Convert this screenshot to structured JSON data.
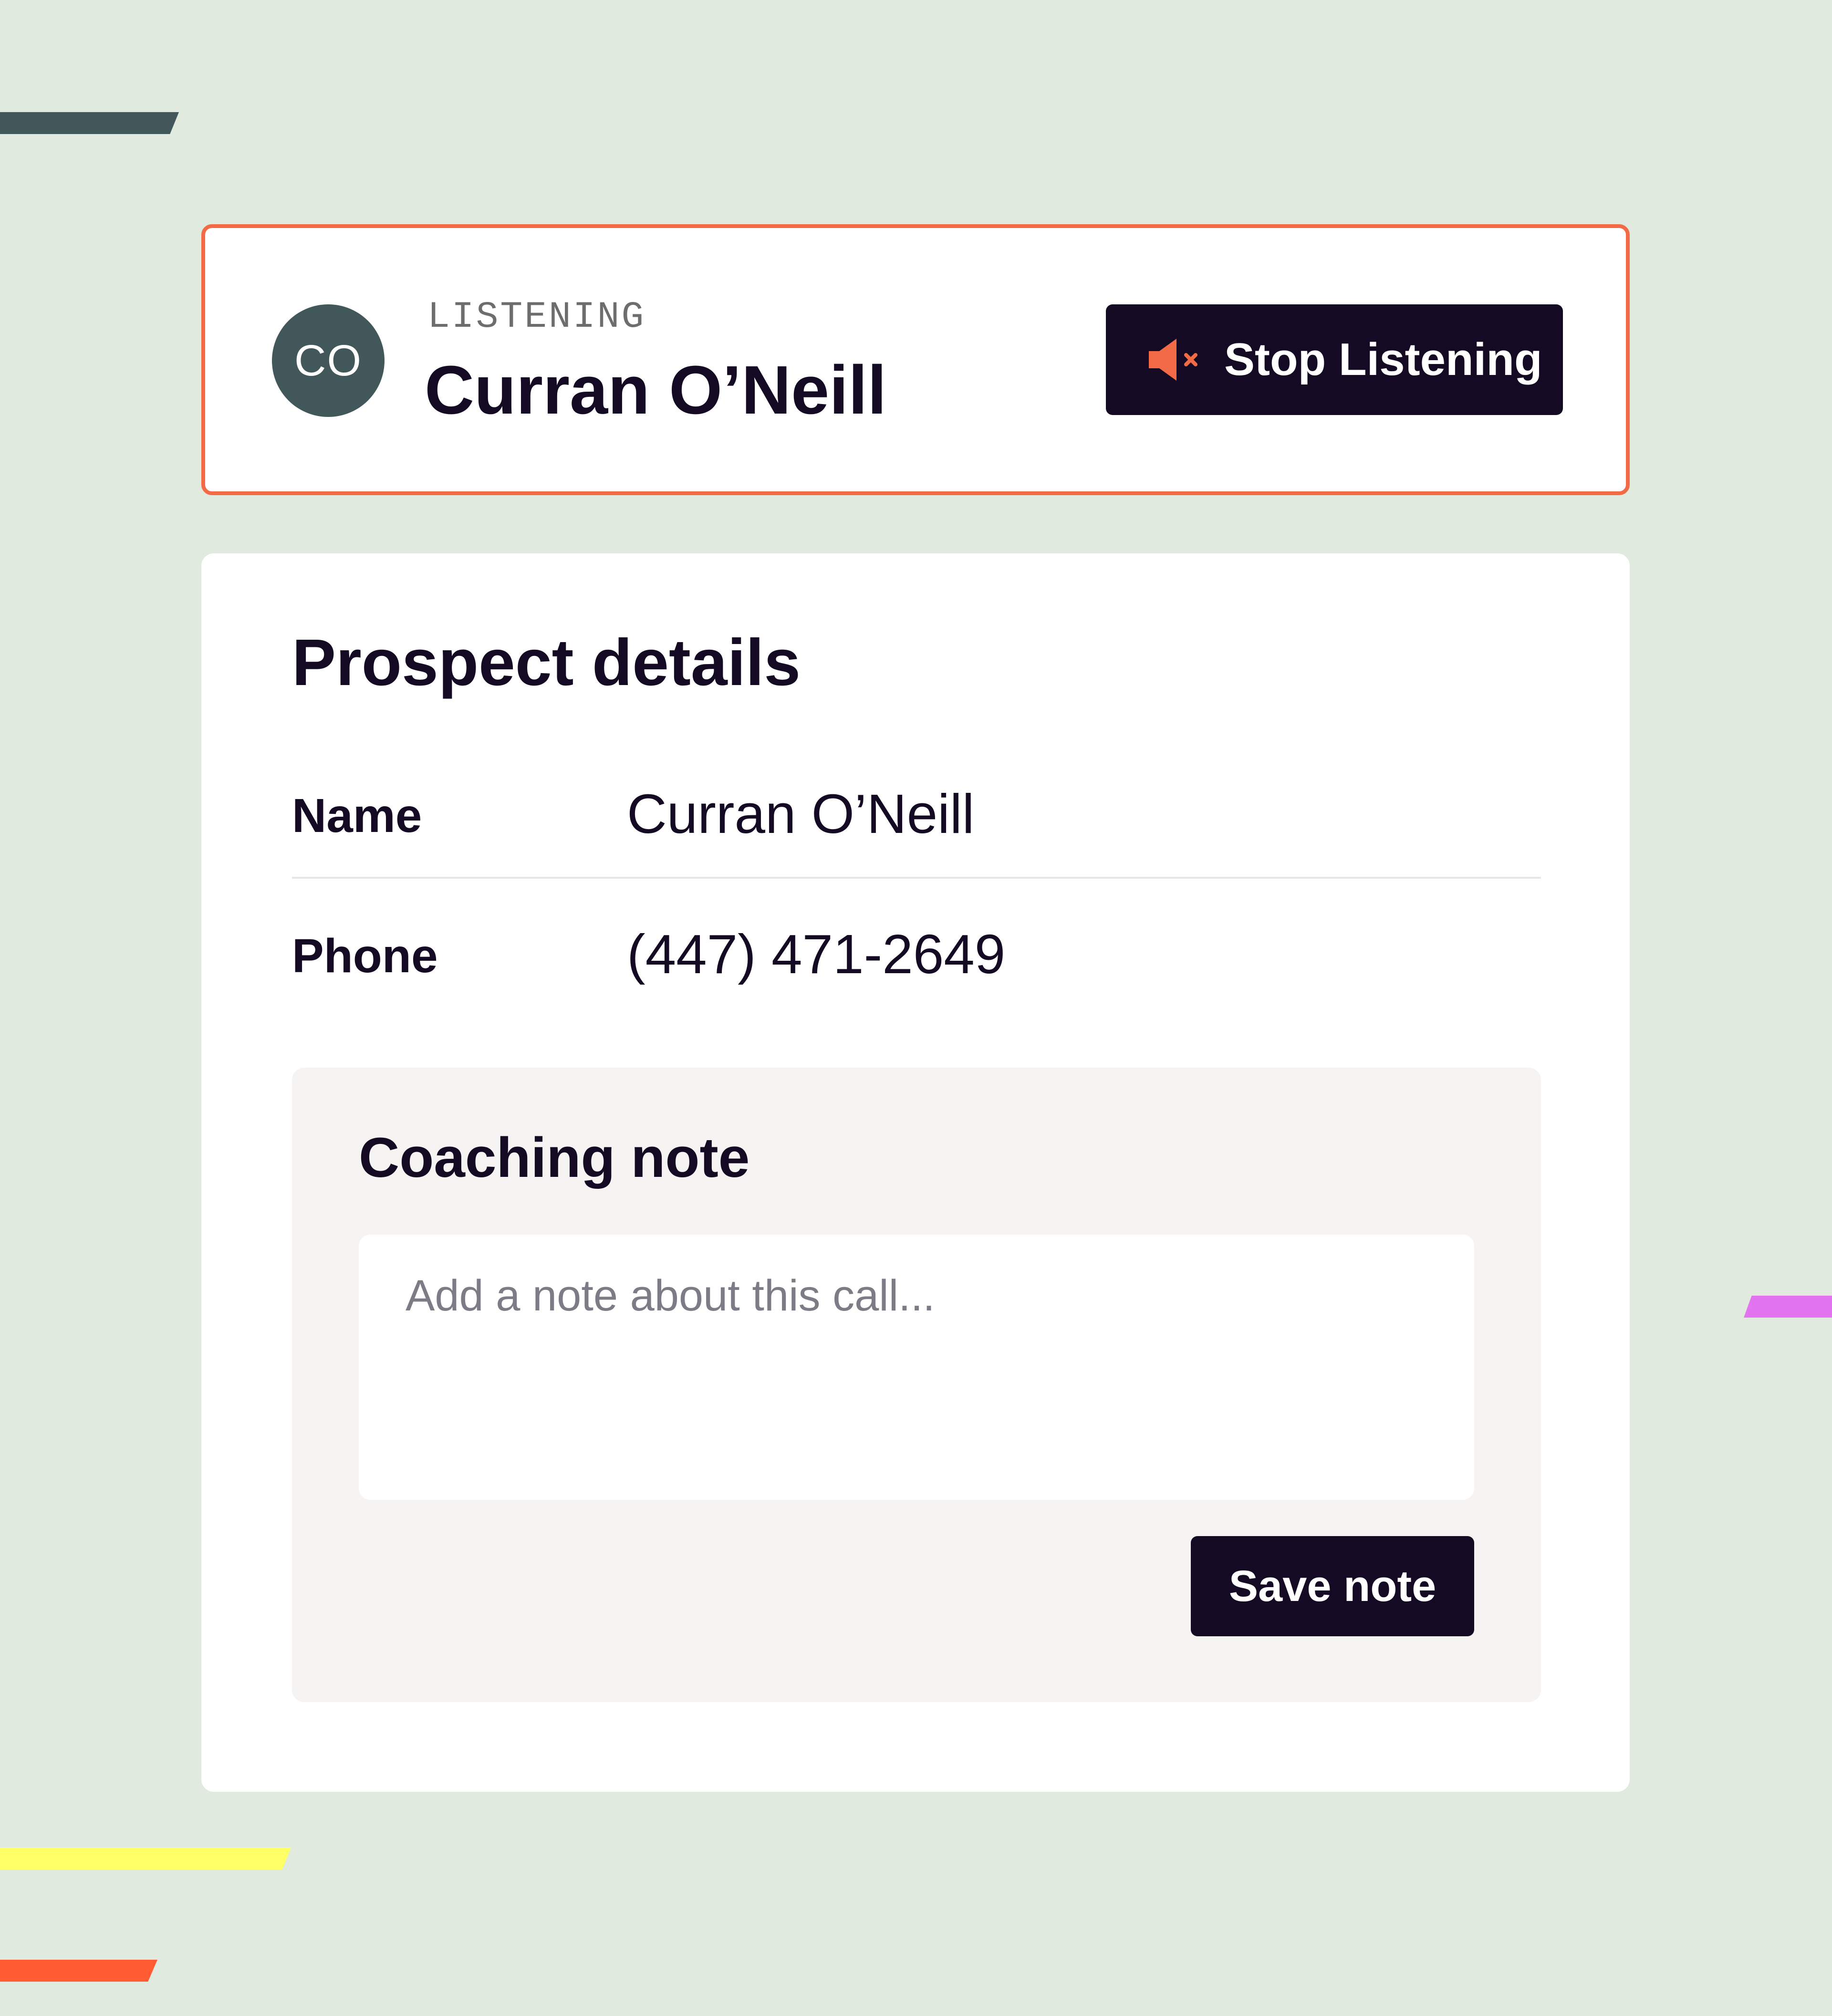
{
  "listening_card": {
    "avatar_initials": "CO",
    "status": "LISTENING",
    "name": "Curran O’Neill",
    "stop_button_label": "Stop Listening",
    "stop_icon": "speaker-muted-icon",
    "border_color": "#f26a46"
  },
  "prospect": {
    "title": "Prospect details",
    "fields": [
      {
        "label": "Name",
        "value": "Curran O’Neill"
      },
      {
        "label": "Phone",
        "value": "(447) 471-2649"
      }
    ]
  },
  "coaching_note": {
    "title": "Coaching note",
    "input_value": "",
    "placeholder": "Add a note about this call...",
    "save_button_label": "Save note"
  },
  "colors": {
    "background": "#e0eadf",
    "button": "#150a24",
    "accent_orange": "#f26a46",
    "avatar": "#41575a"
  }
}
